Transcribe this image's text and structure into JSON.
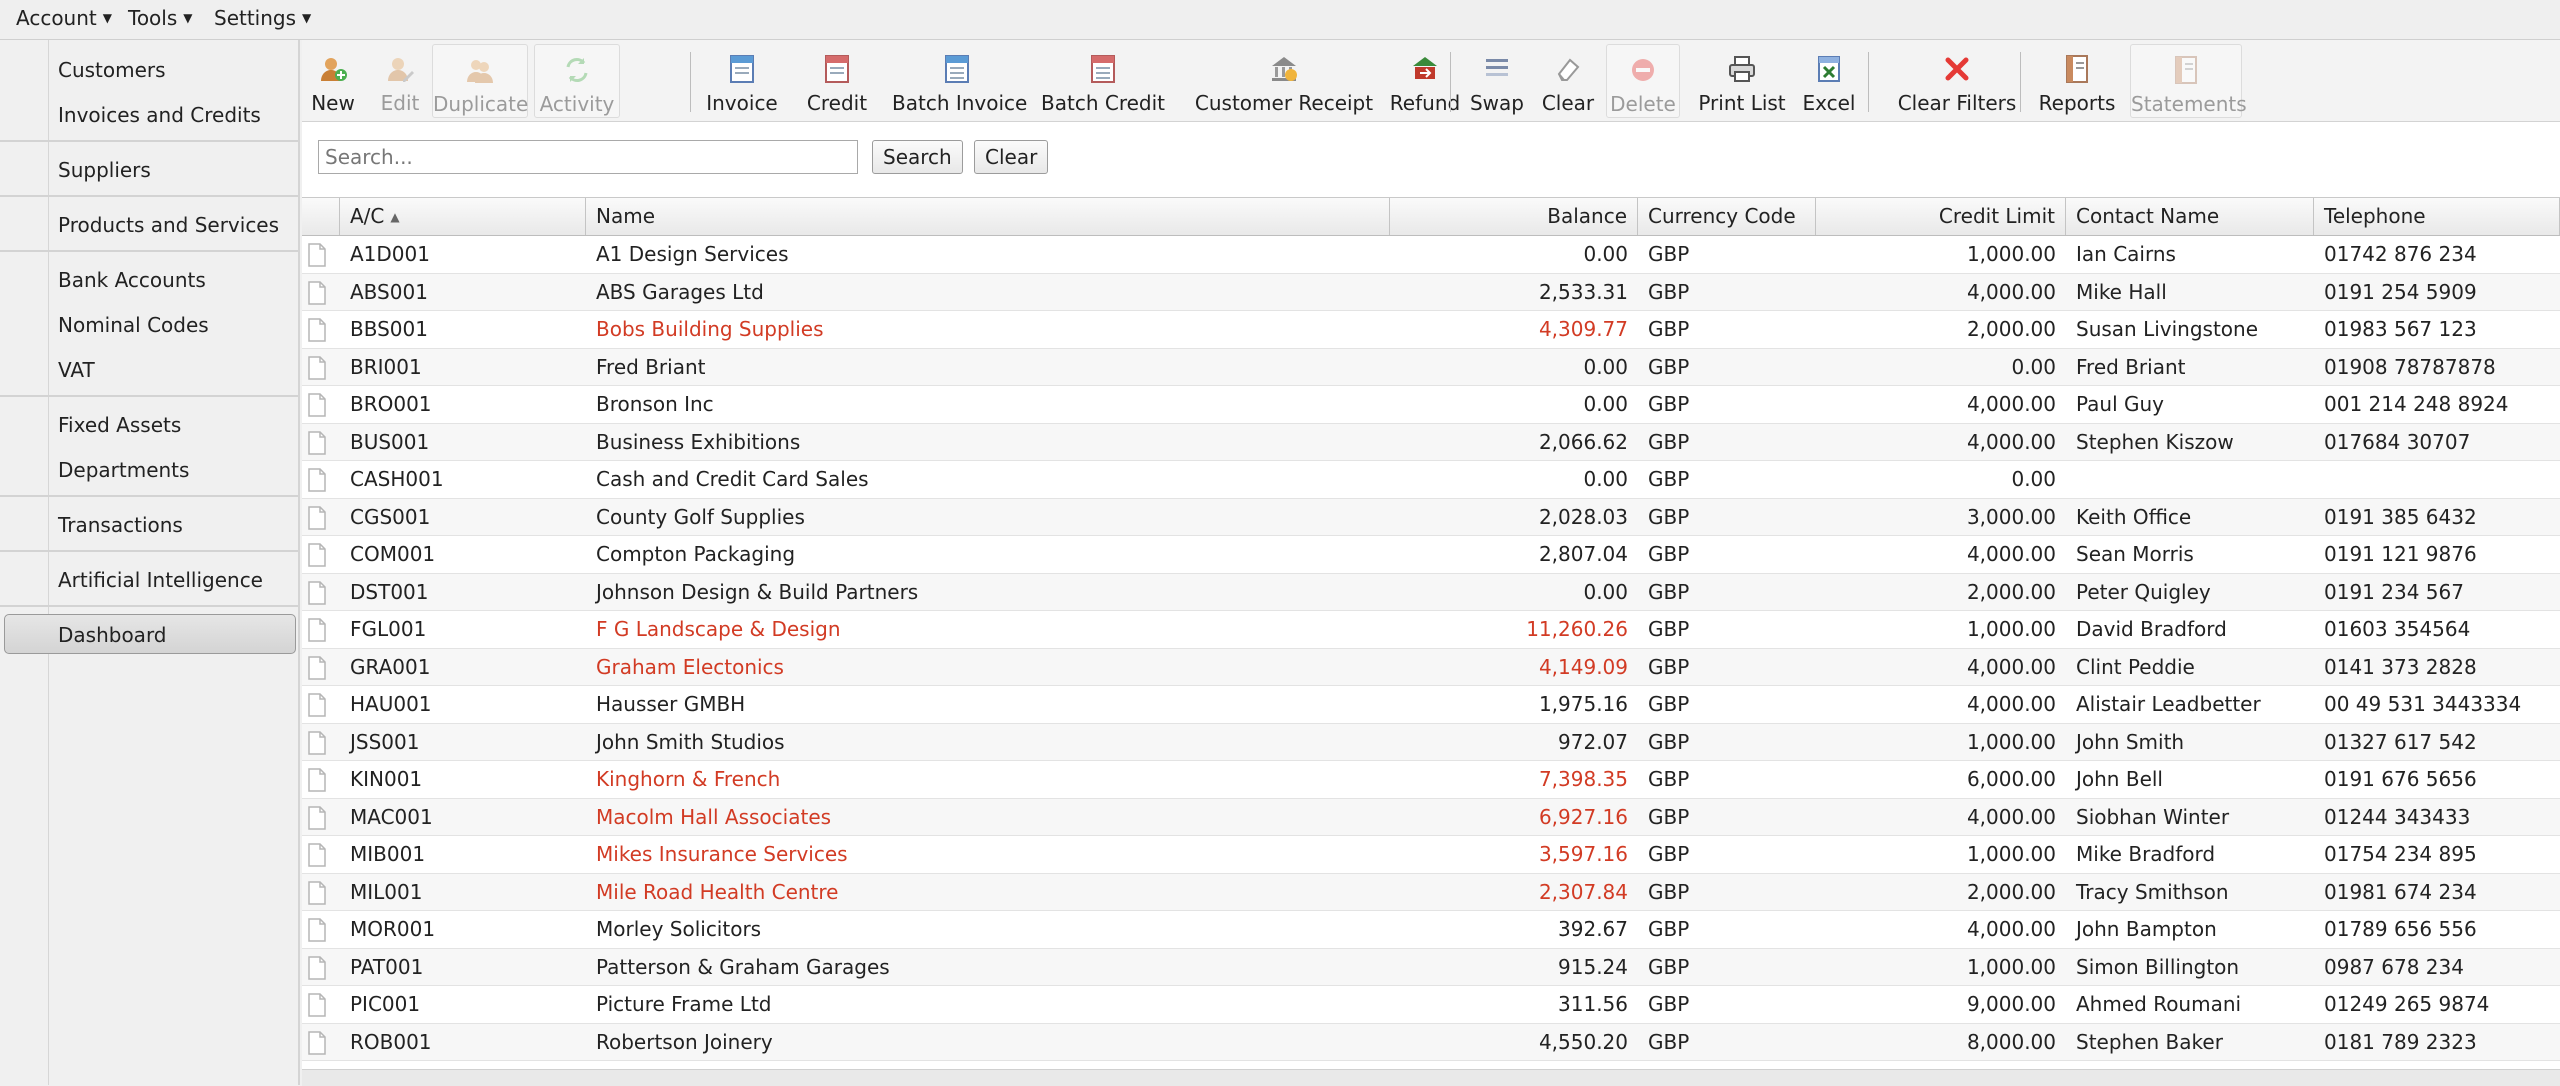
{
  "menu": {
    "account": "Account",
    "tools": "Tools",
    "settings": "Settings"
  },
  "sidebar": {
    "items": [
      {
        "label": "Customers"
      },
      {
        "label": "Invoices and Credits"
      },
      {
        "label": "Suppliers"
      },
      {
        "label": "Products and Services"
      },
      {
        "label": "Bank Accounts"
      },
      {
        "label": "Nominal Codes"
      },
      {
        "label": "VAT"
      },
      {
        "label": "Fixed Assets"
      },
      {
        "label": "Departments"
      },
      {
        "label": "Transactions"
      },
      {
        "label": "Artificial Intelligence"
      },
      {
        "label": "Dashboard"
      }
    ]
  },
  "toolbar": {
    "new": "New",
    "edit": "Edit",
    "duplicate": "Duplicate",
    "activity": "Activity",
    "invoice": "Invoice",
    "credit": "Credit",
    "batch_invoice": "Batch Invoice",
    "batch_credit": "Batch Credit",
    "customer_receipt": "Customer Receipt",
    "refund": "Refund",
    "swap": "Swap",
    "clear": "Clear",
    "delete": "Delete",
    "print_list": "Print List",
    "excel": "Excel",
    "clear_filters": "Clear Filters",
    "reports": "Reports",
    "statements": "Statements"
  },
  "search": {
    "placeholder": "Search...",
    "value": "",
    "search_label": "Search",
    "clear_label": "Clear"
  },
  "grid": {
    "columns": {
      "ac": "A/C",
      "name": "Name",
      "balance": "Balance",
      "currency": "Currency Code",
      "credit_limit": "Credit Limit",
      "contact": "Contact Name",
      "telephone": "Telephone"
    },
    "rows": [
      {
        "ac": "A1D001",
        "name": "A1 Design Services",
        "balance": "0.00",
        "currency": "GBP",
        "credit_limit": "1,000.00",
        "contact": "Ian Cairns",
        "telephone": "01742 876 234",
        "overdue": false
      },
      {
        "ac": "ABS001",
        "name": "ABS Garages Ltd",
        "balance": "2,533.31",
        "currency": "GBP",
        "credit_limit": "4,000.00",
        "contact": "Mike Hall",
        "telephone": "0191 254 5909",
        "overdue": false
      },
      {
        "ac": "BBS001",
        "name": "Bobs Building Supplies",
        "balance": "4,309.77",
        "currency": "GBP",
        "credit_limit": "2,000.00",
        "contact": "Susan Livingstone",
        "telephone": "01983 567 123",
        "overdue": true
      },
      {
        "ac": "BRI001",
        "name": "Fred Briant",
        "balance": "0.00",
        "currency": "GBP",
        "credit_limit": "0.00",
        "contact": "Fred Briant",
        "telephone": "01908 78787878",
        "overdue": false
      },
      {
        "ac": "BRO001",
        "name": "Bronson Inc",
        "balance": "0.00",
        "currency": "GBP",
        "credit_limit": "4,000.00",
        "contact": "Paul Guy",
        "telephone": "001 214 248 8924",
        "overdue": false
      },
      {
        "ac": "BUS001",
        "name": "Business Exhibitions",
        "balance": "2,066.62",
        "currency": "GBP",
        "credit_limit": "4,000.00",
        "contact": "Stephen Kiszow",
        "telephone": "017684 30707",
        "overdue": false
      },
      {
        "ac": "CASH001",
        "name": "Cash and Credit Card Sales",
        "balance": "0.00",
        "currency": "GBP",
        "credit_limit": "0.00",
        "contact": "",
        "telephone": "",
        "overdue": false
      },
      {
        "ac": "CGS001",
        "name": "County Golf Supplies",
        "balance": "2,028.03",
        "currency": "GBP",
        "credit_limit": "3,000.00",
        "contact": "Keith Office",
        "telephone": "0191 385 6432",
        "overdue": false
      },
      {
        "ac": "COM001",
        "name": "Compton Packaging",
        "balance": "2,807.04",
        "currency": "GBP",
        "credit_limit": "4,000.00",
        "contact": "Sean Morris",
        "telephone": "0191 121 9876",
        "overdue": false
      },
      {
        "ac": "DST001",
        "name": "Johnson Design & Build Partners",
        "balance": "0.00",
        "currency": "GBP",
        "credit_limit": "2,000.00",
        "contact": "Peter Quigley",
        "telephone": "0191 234 567",
        "overdue": false
      },
      {
        "ac": "FGL001",
        "name": "F G Landscape & Design",
        "balance": "11,260.26",
        "currency": "GBP",
        "credit_limit": "1,000.00",
        "contact": "David Bradford",
        "telephone": "01603 354564",
        "overdue": true
      },
      {
        "ac": "GRA001",
        "name": "Graham Electonics",
        "balance": "4,149.09",
        "currency": "GBP",
        "credit_limit": "4,000.00",
        "contact": "Clint Peddie",
        "telephone": "0141 373 2828",
        "overdue": true
      },
      {
        "ac": "HAU001",
        "name": "Hausser GMBH",
        "balance": "1,975.16",
        "currency": "GBP",
        "credit_limit": "4,000.00",
        "contact": "Alistair Leadbetter",
        "telephone": "00 49 531 3443334",
        "overdue": false
      },
      {
        "ac": "JSS001",
        "name": "John Smith Studios",
        "balance": "972.07",
        "currency": "GBP",
        "credit_limit": "1,000.00",
        "contact": "John Smith",
        "telephone": "01327 617 542",
        "overdue": false
      },
      {
        "ac": "KIN001",
        "name": "Kinghorn & French",
        "balance": "7,398.35",
        "currency": "GBP",
        "credit_limit": "6,000.00",
        "contact": "John Bell",
        "telephone": "0191 676 5656",
        "overdue": true
      },
      {
        "ac": "MAC001",
        "name": "Macolm Hall Associates",
        "balance": "6,927.16",
        "currency": "GBP",
        "credit_limit": "4,000.00",
        "contact": "Siobhan Winter",
        "telephone": "01244 343433",
        "overdue": true
      },
      {
        "ac": "MIB001",
        "name": "Mikes Insurance Services",
        "balance": "3,597.16",
        "currency": "GBP",
        "credit_limit": "1,000.00",
        "contact": "Mike Bradford",
        "telephone": "01754 234 895",
        "overdue": true
      },
      {
        "ac": "MIL001",
        "name": "Mile Road Health Centre",
        "balance": "2,307.84",
        "currency": "GBP",
        "credit_limit": "2,000.00",
        "contact": "Tracy Smithson",
        "telephone": "01981 674 234",
        "overdue": true
      },
      {
        "ac": "MOR001",
        "name": "Morley Solicitors",
        "balance": "392.67",
        "currency": "GBP",
        "credit_limit": "4,000.00",
        "contact": "John Bampton",
        "telephone": "01789 656 556",
        "overdue": false
      },
      {
        "ac": "PAT001",
        "name": "Patterson & Graham Garages",
        "balance": "915.24",
        "currency": "GBP",
        "credit_limit": "1,000.00",
        "contact": "Simon Billington",
        "telephone": "0987 678 234",
        "overdue": false
      },
      {
        "ac": "PIC001",
        "name": "Picture Frame Ltd",
        "balance": "311.56",
        "currency": "GBP",
        "credit_limit": "9,000.00",
        "contact": "Ahmed Roumani",
        "telephone": "01249 265 9874",
        "overdue": false
      },
      {
        "ac": "ROB001",
        "name": "Robertson Joinery",
        "balance": "4,550.20",
        "currency": "GBP",
        "credit_limit": "8,000.00",
        "contact": "Stephen Baker",
        "telephone": "0181 789 2323",
        "overdue": false
      }
    ]
  },
  "colors": {
    "overdue_text": "#d23b24",
    "toolbar_bg": "#f3f3f3",
    "sidebar_bg": "#f0f0f0"
  }
}
